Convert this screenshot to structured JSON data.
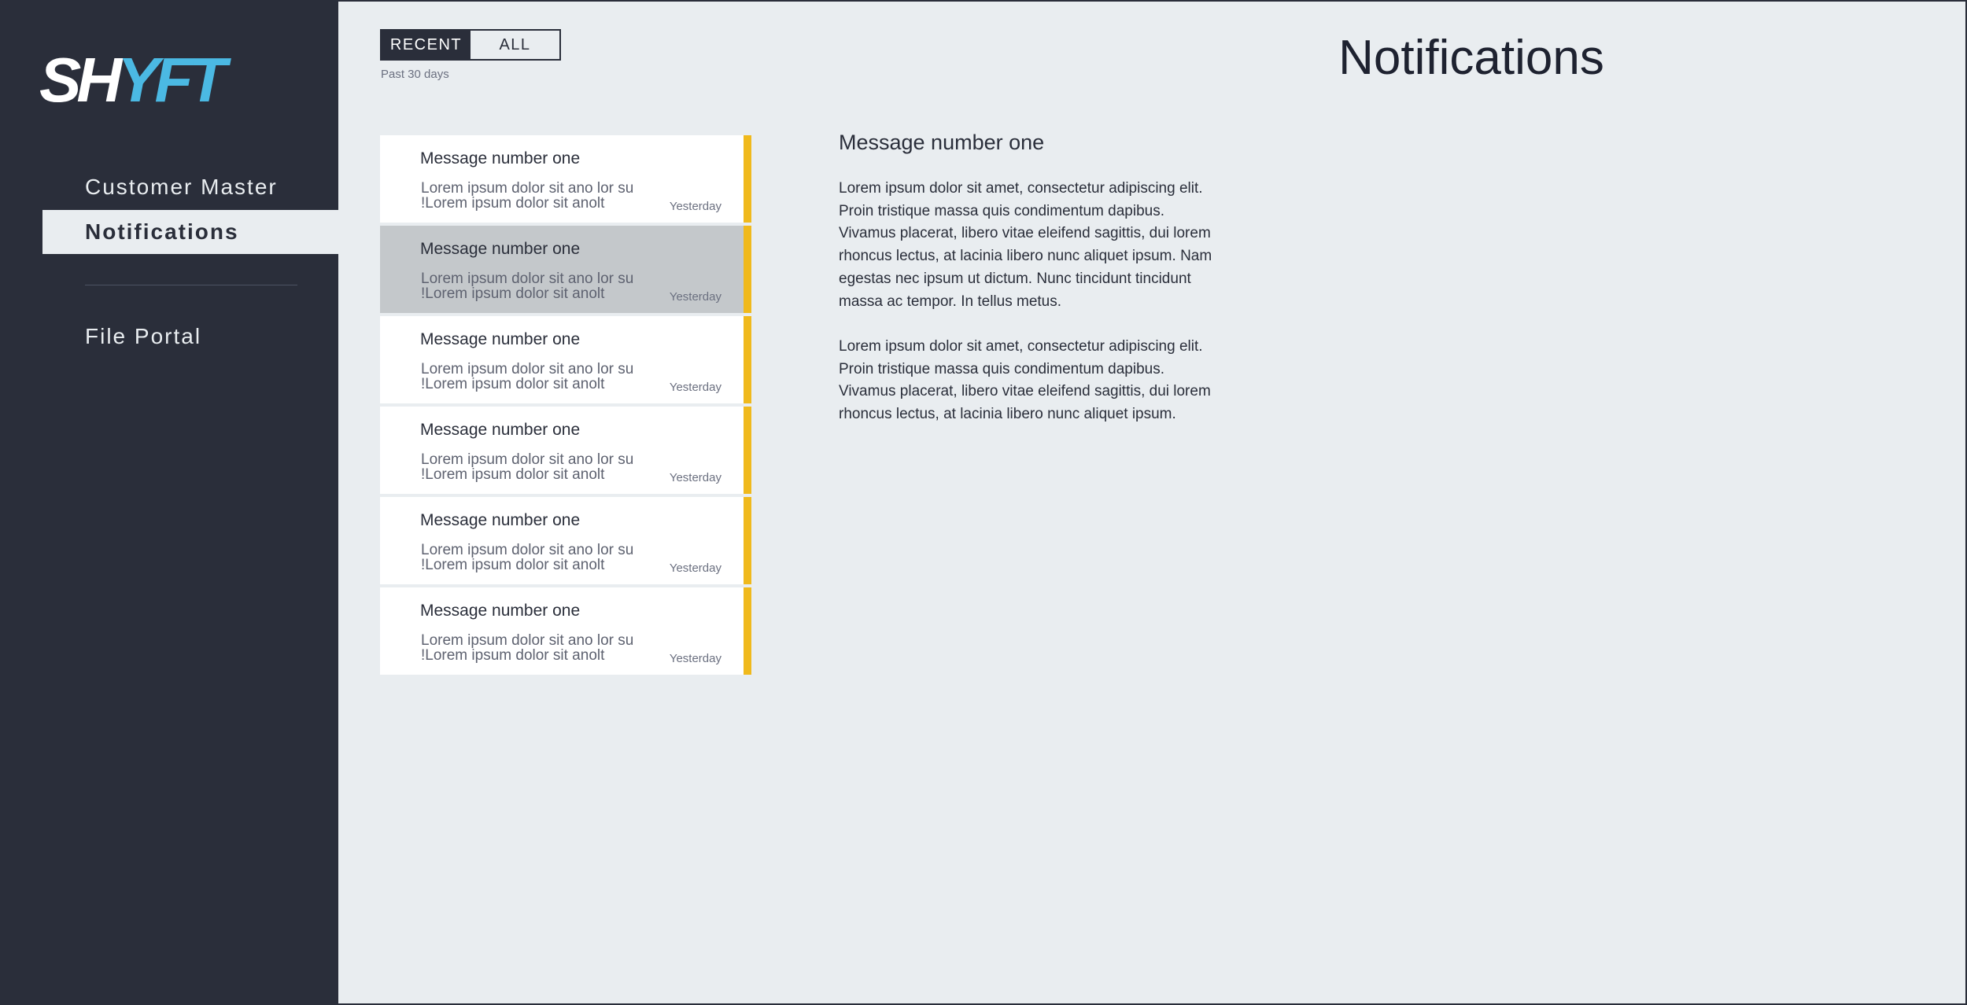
{
  "logo": {
    "part1": "SH",
    "part2": "YFT"
  },
  "sidebar": {
    "items": [
      {
        "label": "Customer Master"
      },
      {
        "label": "Notifications"
      },
      {
        "label": "File Portal"
      }
    ]
  },
  "colors": {
    "sidebar": "#2a2e3a",
    "accent": "#f0b91c",
    "brand_blue": "#4bb9e3",
    "background": "#e9edf0"
  },
  "tabs": {
    "recent": "RECENT",
    "all": "ALL",
    "active": "RECENT"
  },
  "range_label": "Past 30 days",
  "page_title": "Notifications",
  "messages": [
    {
      "title": "Message number one",
      "preview": "Lorem ipsum dolor sit ano lor su\n!Lorem ipsum dolor sit anolt",
      "time": "Yesterday"
    },
    {
      "title": "Message number one",
      "preview": "Lorem ipsum dolor sit ano lor su\n!Lorem ipsum dolor sit anolt",
      "time": "Yesterday"
    },
    {
      "title": "Message number one",
      "preview": "Lorem ipsum dolor sit ano lor su\n!Lorem ipsum dolor sit anolt",
      "time": "Yesterday"
    },
    {
      "title": "Message number one",
      "preview": "Lorem ipsum dolor sit ano lor su\n!Lorem ipsum dolor sit anolt",
      "time": "Yesterday"
    },
    {
      "title": "Message number one",
      "preview": "Lorem ipsum dolor sit ano lor su\n!Lorem ipsum dolor sit anolt",
      "time": "Yesterday"
    },
    {
      "title": "Message number one",
      "preview": "Lorem ipsum dolor sit ano lor su\n!Lorem ipsum dolor sit anolt",
      "time": "Yesterday"
    }
  ],
  "detail": {
    "title": "Message number one",
    "paragraphs": [
      "Lorem ipsum dolor sit amet, consectetur adipiscing elit. Proin tristique massa quis condimentum dapibus. Vivamus placerat, libero vitae eleifend sagittis, dui lorem rhoncus lectus, at lacinia libero nunc aliquet ipsum. Nam egestas nec ipsum ut dictum. Nunc tincidunt tincidunt massa ac tempor. In tellus metus.",
      "Lorem ipsum dolor sit amet, consectetur adipiscing elit. Proin tristique massa quis condimentum dapibus. Vivamus placerat, libero vitae eleifend sagittis, dui lorem rhoncus lectus, at lacinia libero nunc aliquet ipsum."
    ]
  }
}
